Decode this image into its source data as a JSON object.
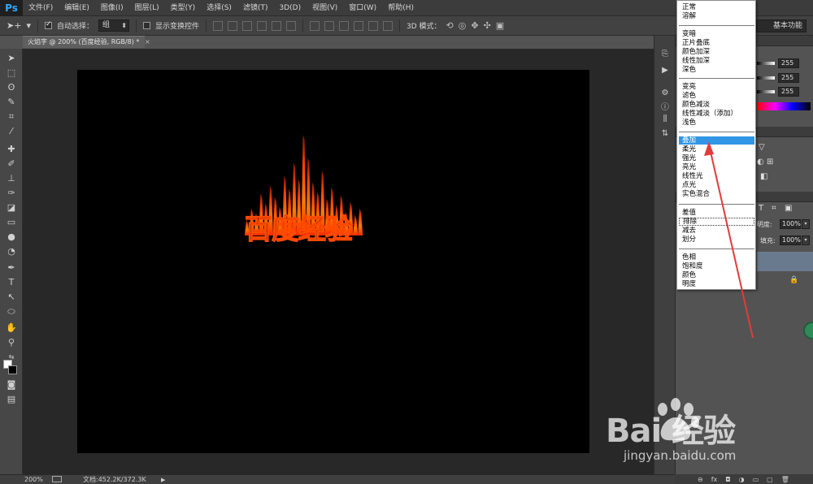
{
  "app": {
    "logo": "Ps"
  },
  "menubar": {
    "items": [
      "文件(F)",
      "编辑(E)",
      "图像(I)",
      "图层(L)",
      "类型(Y)",
      "选择(S)",
      "滤镜(T)",
      "3D(D)",
      "视图(V)",
      "窗口(W)",
      "帮助(H)"
    ]
  },
  "options": {
    "auto_select_label": "自动选择：",
    "auto_select_checked": true,
    "auto_select_value": "组",
    "show_transform_label": "显示变换控件",
    "show_transform_checked": false,
    "mode3d_label": "3D 模式：",
    "workspace_value": "基本功能"
  },
  "document": {
    "tab_title": "火焰字 @ 200% (百度经验, RGB/8) *",
    "close_glyph": "×",
    "artwork_text": "百度经验"
  },
  "statusbar": {
    "zoom": "200%",
    "doc_size": "文档:452.2K/372.3K"
  },
  "right_panel": {
    "slider_values": [
      "255",
      "255",
      "255"
    ],
    "opacity_label": "不透明度:",
    "opacity_label_visible": "明度:",
    "opacity_value": "100%",
    "fill_label": "填充:",
    "fill_value": "100%"
  },
  "blend_mode_menu": {
    "groups": [
      [
        "正常",
        "溶解"
      ],
      [
        "变暗",
        "正片叠底",
        "颜色加深",
        "线性加深",
        "深色"
      ],
      [
        "变亮",
        "滤色",
        "颜色减淡",
        "线性减淡（添加）",
        "浅色"
      ],
      [
        "叠加",
        "柔光",
        "强光",
        "亮光",
        "线性光",
        "点光",
        "实色混合"
      ],
      [
        "差值",
        "排除",
        "减去",
        "划分"
      ],
      [
        "色相",
        "饱和度",
        "颜色",
        "明度"
      ]
    ],
    "selected": "叠加",
    "hovered": "排除"
  },
  "watermark": {
    "logo_text": "Bai  经验",
    "url": "jingyan.baidu.com"
  },
  "colors": {
    "selection": "#3296e6",
    "annotation_arrow": "#e23b3b",
    "canvas": "#000000"
  }
}
